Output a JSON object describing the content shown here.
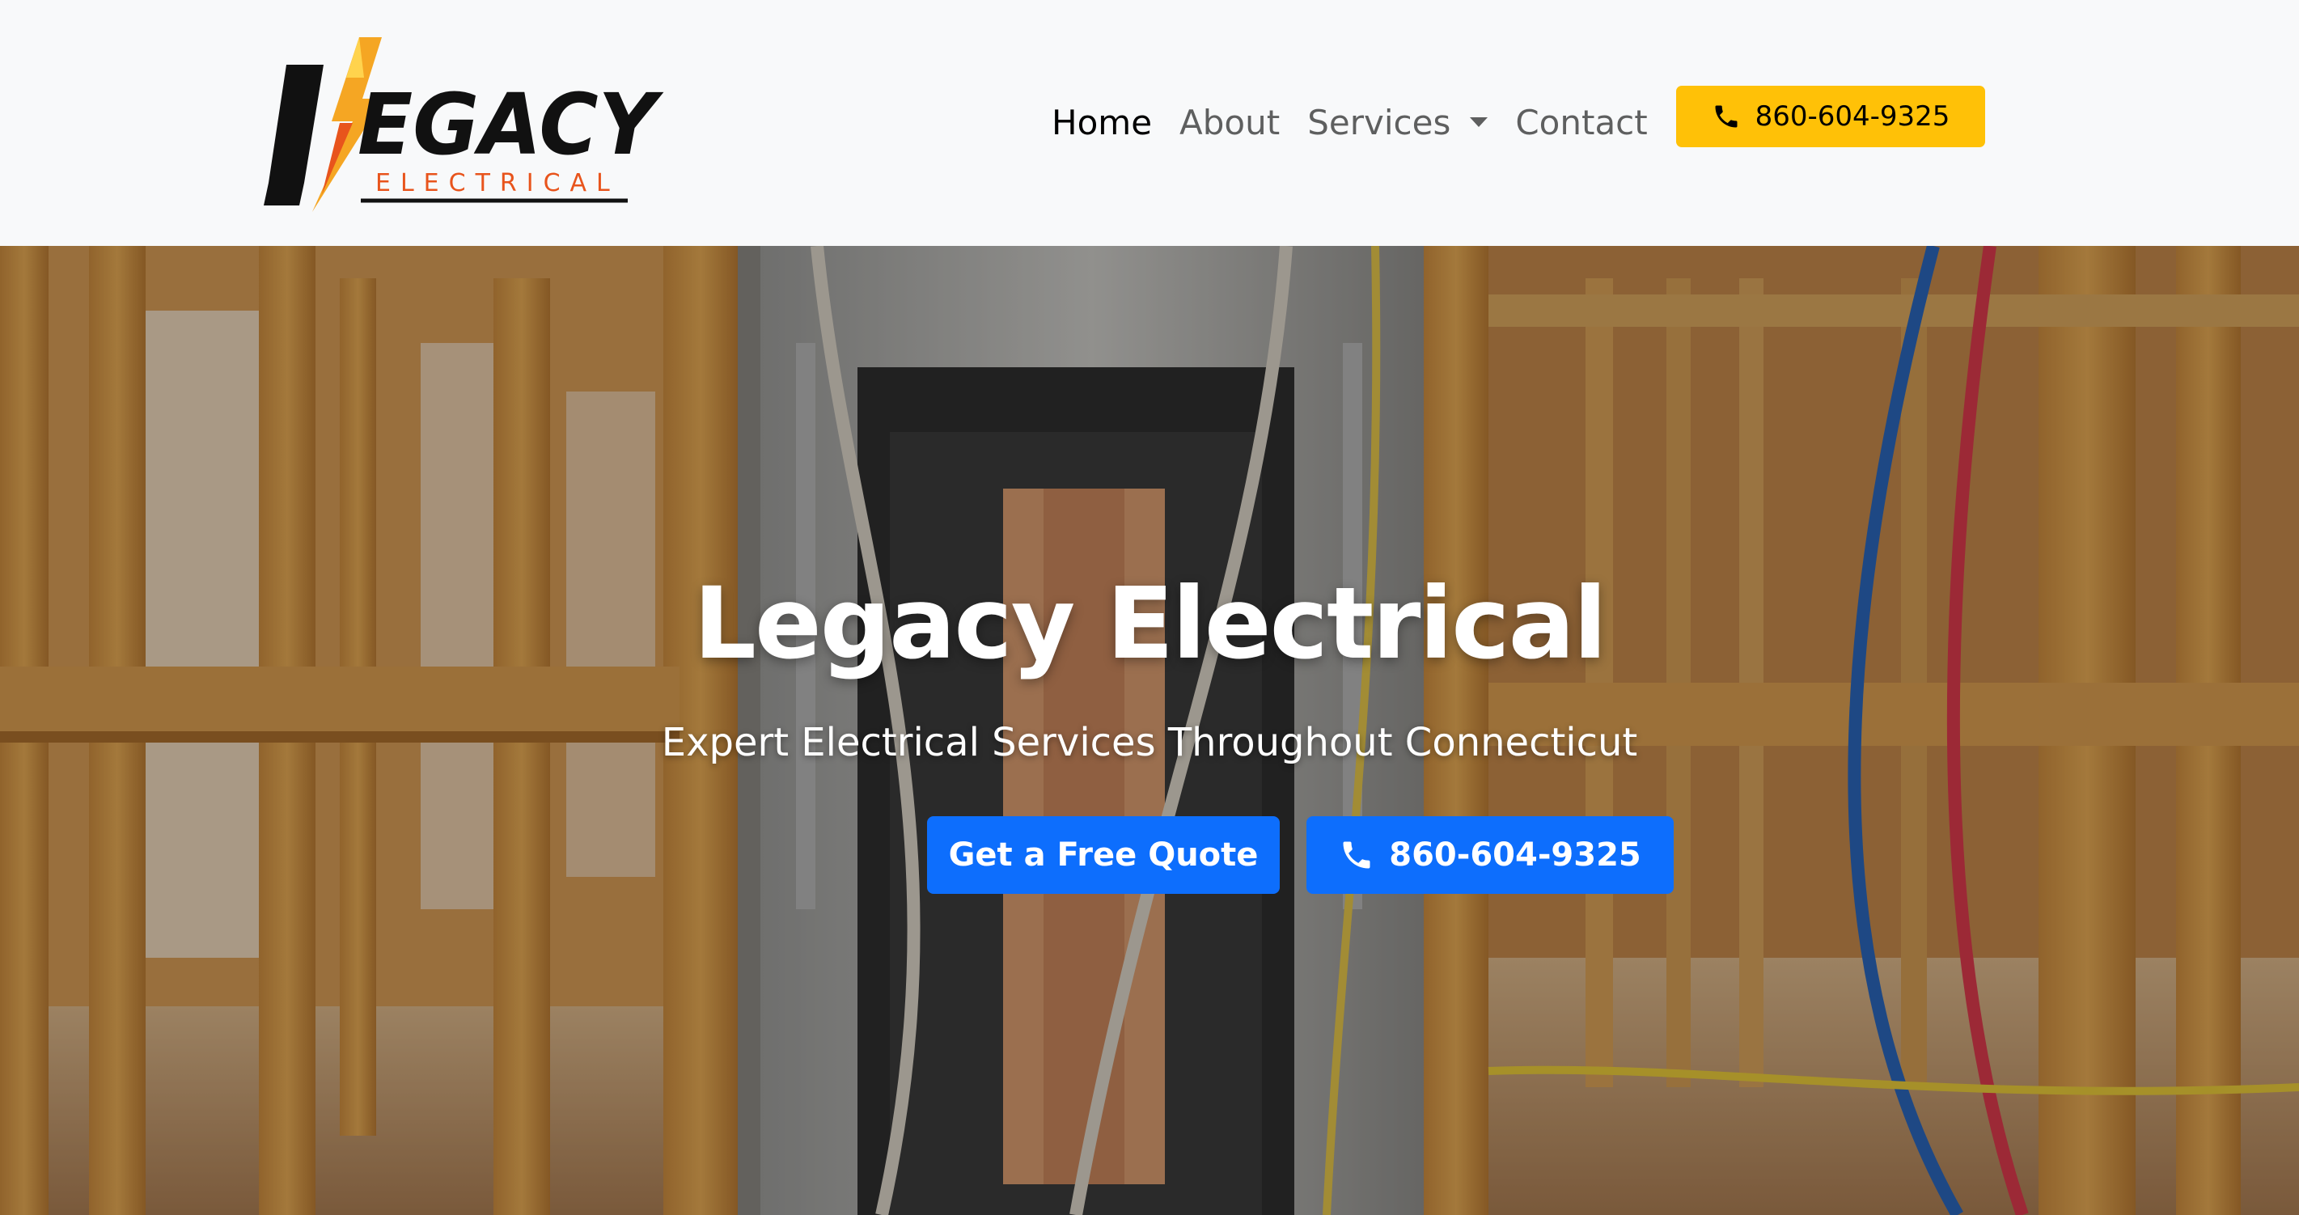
{
  "brand": {
    "logo_word": "EGACY",
    "logo_sub": "ELECTRICAL",
    "logo_initial": "L",
    "colors": {
      "bolt": "#f5a623",
      "bolt_dark": "#e8541c",
      "accent_red": "#e8541c",
      "ink": "#111111"
    }
  },
  "nav": {
    "links": [
      {
        "label": "Home",
        "active": true
      },
      {
        "label": "About",
        "active": false
      },
      {
        "label": "Services",
        "active": false,
        "has_dropdown": true
      },
      {
        "label": "Contact",
        "active": false
      }
    ],
    "call_button": {
      "label": "860-604-9325",
      "icon": "phone-icon",
      "color": "#ffc107"
    }
  },
  "hero": {
    "title": "Legacy Electrical",
    "subtitle": "Expert Electrical Services Throughout Connecticut",
    "buttons": {
      "quote": "Get a Free Quote",
      "phone": "860-604-9325",
      "phone_icon": "phone-icon",
      "color": "#0d6efd"
    }
  }
}
